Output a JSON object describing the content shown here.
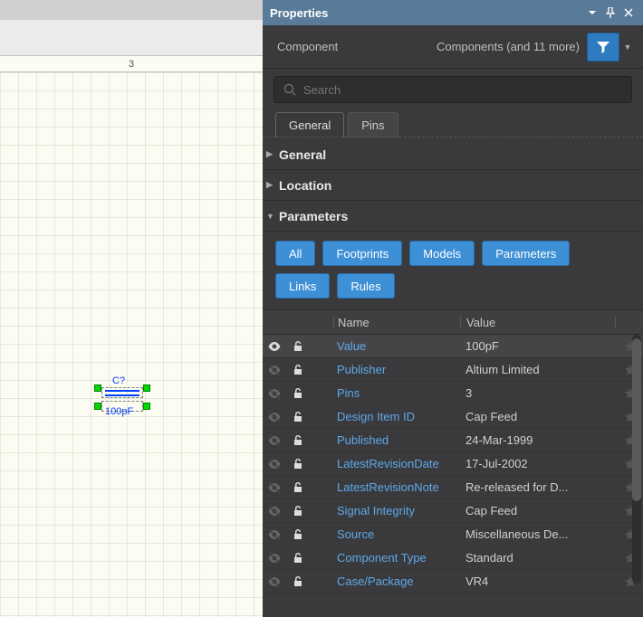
{
  "canvas": {
    "ruler_mark": "3",
    "comp_ref": "C?",
    "comp_value": "100pF"
  },
  "panel": {
    "title": "Properties",
    "header_label": "Component",
    "filter_text": "Components (and 11 more)",
    "search_placeholder": "Search",
    "tabs": [
      {
        "label": "General",
        "active": true
      },
      {
        "label": "Pins",
        "active": false
      }
    ],
    "sections": {
      "general": "General",
      "location": "Location",
      "parameters": "Parameters"
    },
    "chips": [
      {
        "label": "All"
      },
      {
        "label": "Footprints"
      },
      {
        "label": "Models"
      },
      {
        "label": "Parameters"
      },
      {
        "label": "Links"
      },
      {
        "label": "Rules"
      }
    ],
    "columns": {
      "name": "Name",
      "value": "Value"
    },
    "rows": [
      {
        "visible": true,
        "name": "Value",
        "value": "100pF",
        "sel": true
      },
      {
        "visible": false,
        "name": "Publisher",
        "value": "Altium Limited"
      },
      {
        "visible": false,
        "name": "Pins",
        "value": "3"
      },
      {
        "visible": false,
        "name": "Design Item ID",
        "value": "Cap Feed"
      },
      {
        "visible": false,
        "name": "Published",
        "value": "24-Mar-1999"
      },
      {
        "visible": false,
        "name": "LatestRevisionDate",
        "value": "17-Jul-2002"
      },
      {
        "visible": false,
        "name": "LatestRevisionNote",
        "value": "Re-released for D..."
      },
      {
        "visible": false,
        "name": "Signal Integrity",
        "value": "Cap Feed"
      },
      {
        "visible": false,
        "name": "Source",
        "value": "Miscellaneous De..."
      },
      {
        "visible": false,
        "name": "Component Type",
        "value": "Standard"
      },
      {
        "visible": false,
        "name": "Case/Package",
        "value": "VR4"
      }
    ]
  }
}
